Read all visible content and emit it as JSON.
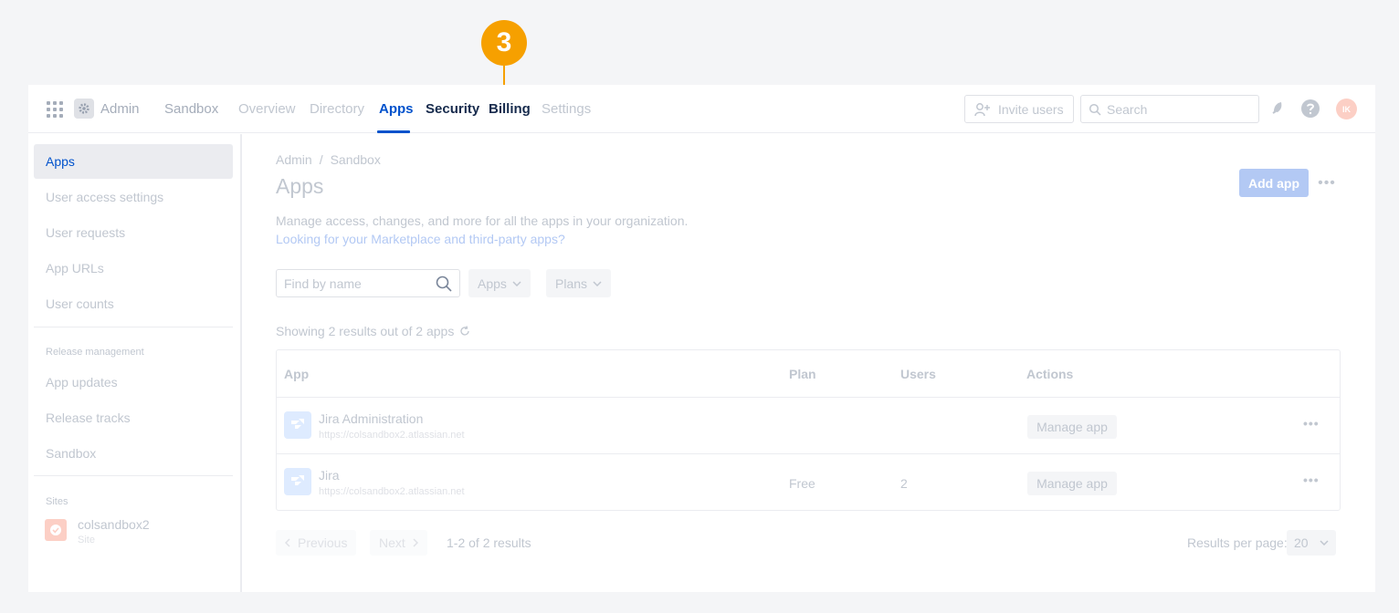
{
  "callout": {
    "number": "3",
    "color": "#f6a000"
  },
  "topnav": {
    "admin": "Admin",
    "sandbox": "Sandbox",
    "items": [
      "Overview",
      "Directory",
      "Apps",
      "Security",
      "Billing",
      "Settings"
    ],
    "active": "Apps",
    "invite_label": "Invite users",
    "search_placeholder": "Search",
    "avatar_initials": "IK"
  },
  "sidebar": {
    "items": [
      "Apps",
      "User access settings",
      "User requests",
      "App URLs",
      "User counts"
    ],
    "release_heading": "Release management",
    "release_items": [
      "App updates",
      "Release tracks",
      "Sandbox"
    ],
    "sites_heading": "Sites",
    "site_name": "colsandbox2",
    "site_sub": "Site"
  },
  "main": {
    "breadcrumb": [
      "Admin",
      "/",
      "Sandbox"
    ],
    "title": "Apps",
    "add_app_label": "Add app",
    "more_label": "•••",
    "description": "Manage access, changes, and more for all the apps in your organization.",
    "marketplace_link": "Looking for your Marketplace and third-party apps?",
    "find_placeholder": "Find by name",
    "filter_apps": "Apps",
    "filter_plans": "Plans",
    "showing_text": "Showing 2 results out of 2 apps",
    "table": {
      "headers": {
        "app": "App",
        "plan": "Plan",
        "users": "Users",
        "actions": "Actions"
      },
      "rows": [
        {
          "name": "Jira Administration",
          "url": "https://colsandbox2.atlassian.net",
          "plan": "",
          "users": "",
          "action": "Manage app"
        },
        {
          "name": "Jira",
          "url": "https://colsandbox2.atlassian.net",
          "plan": "Free",
          "users": "2",
          "action": "Manage app"
        }
      ]
    },
    "pager": {
      "previous": "Previous",
      "next": "Next",
      "summary": "1-2 of 2 results",
      "rpp_label": "Results per page:",
      "rpp_value": "20"
    }
  }
}
